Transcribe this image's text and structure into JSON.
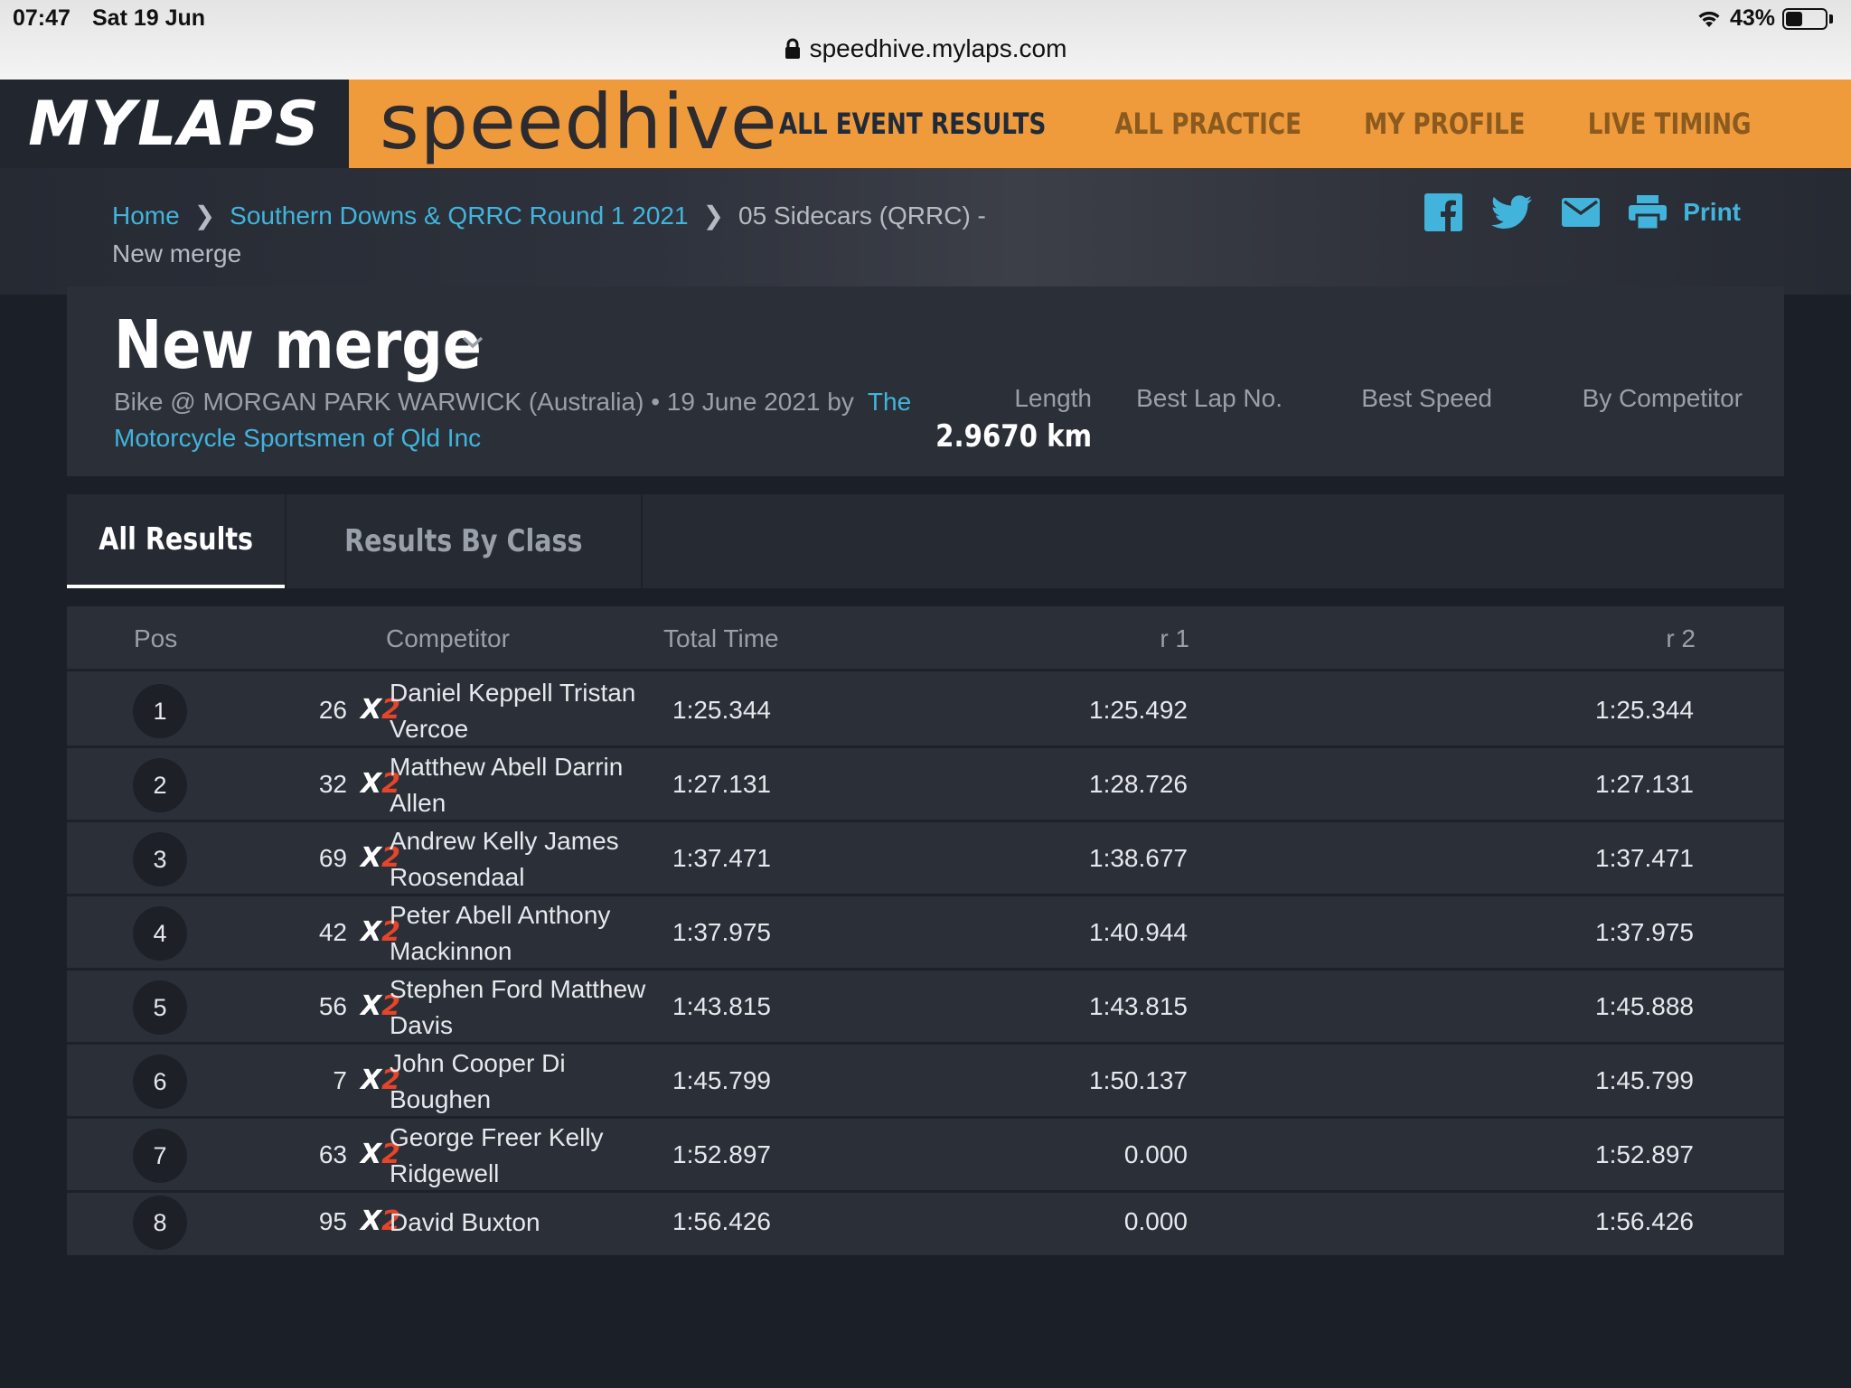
{
  "status": {
    "time": "07:47",
    "date": "Sat 19 Jun",
    "battery": "43%",
    "battery_level": 0.43
  },
  "browser": {
    "url": "speedhive.mylaps.com"
  },
  "header": {
    "logo": "MYLAPS",
    "brand": "speedhive",
    "nav": [
      "ALL EVENT RESULTS",
      "ALL PRACTICE",
      "MY PROFILE",
      "LIVE TIMING"
    ],
    "active_nav": "ALL EVENT RESULTS",
    "accent": "#ef9b3c"
  },
  "breadcrumb": {
    "home": "Home",
    "event": "Southern Downs & QRRC Round 1 2021",
    "session": "05 Sidecars (QRRC) -",
    "current": "New merge"
  },
  "share": {
    "icons": [
      "facebook-icon",
      "twitter-icon",
      "mail-icon",
      "print-icon"
    ],
    "print_label": "Print",
    "link_color": "#42b4dc"
  },
  "event": {
    "title": "New merge",
    "meta_prefix": "Bike @ MORGAN PARK WARWICK (Australia) • 19 June 2021 by",
    "organizer": "The Motorcycle Sportsmen of Qld Inc",
    "stats": {
      "length_label": "Length",
      "length_value": "2.9670 km",
      "best_lap_label": "Best Lap No.",
      "best_speed_label": "Best Speed",
      "by_competitor_label": "By Competitor"
    }
  },
  "tabs": [
    "All Results",
    "Results By Class"
  ],
  "table": {
    "columns": [
      "Pos",
      "Competitor",
      "Total Time",
      "r 1",
      "r 2"
    ],
    "class_badge": {
      "text": "X",
      "number": "2",
      "number_color": "#e6452a"
    },
    "rows": [
      {
        "pos": "1",
        "num": "26",
        "competitor": "Daniel Keppell Tristan Vercoe",
        "total": "1:25.344",
        "r1": "1:25.492",
        "r2": "1:25.344"
      },
      {
        "pos": "2",
        "num": "32",
        "competitor": "Matthew Abell Darrin Allen",
        "total": "1:27.131",
        "r1": "1:28.726",
        "r2": "1:27.131"
      },
      {
        "pos": "3",
        "num": "69",
        "competitor": "Andrew Kelly James Roosendaal",
        "total": "1:37.471",
        "r1": "1:38.677",
        "r2": "1:37.471"
      },
      {
        "pos": "4",
        "num": "42",
        "competitor": "Peter Abell Anthony Mackinnon",
        "total": "1:37.975",
        "r1": "1:40.944",
        "r2": "1:37.975"
      },
      {
        "pos": "5",
        "num": "56",
        "competitor": "Stephen Ford Matthew Davis",
        "total": "1:43.815",
        "r1": "1:43.815",
        "r2": "1:45.888"
      },
      {
        "pos": "6",
        "num": "7",
        "competitor": "John Cooper Di Boughen",
        "total": "1:45.799",
        "r1": "1:50.137",
        "r2": "1:45.799"
      },
      {
        "pos": "7",
        "num": "63",
        "competitor": "George Freer Kelly Ridgewell",
        "total": "1:52.897",
        "r1": "0.000",
        "r2": "1:52.897"
      },
      {
        "pos": "8",
        "num": "95",
        "competitor": "David Buxton",
        "total": "1:56.426",
        "r1": "0.000",
        "r2": "1:56.426"
      }
    ]
  }
}
